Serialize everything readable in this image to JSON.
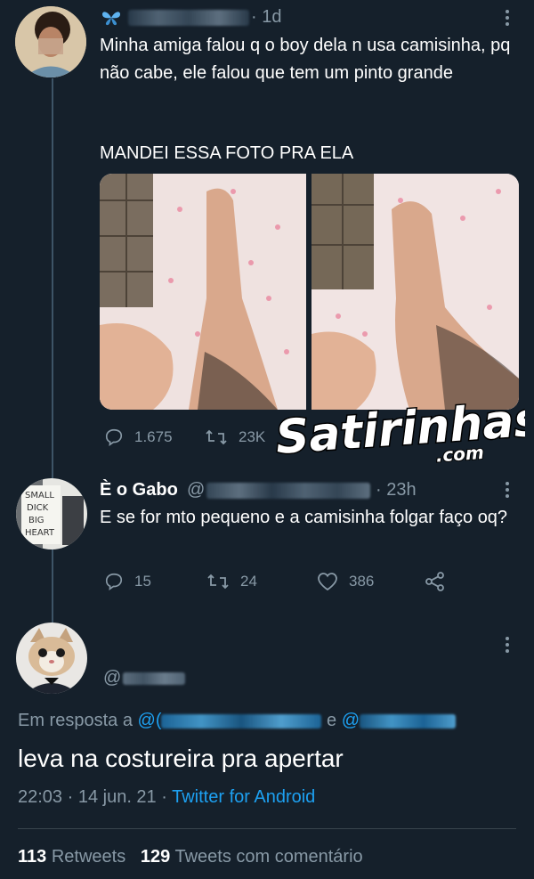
{
  "tweet1": {
    "handle_blur": "",
    "time": "· 1d",
    "text": "Minha amiga falou q o boy dela n usa camisinha, pq não cabe, ele falou que tem um pinto grande",
    "text2": "MANDEI ESSA FOTO PRA ELA",
    "replies": "1.675",
    "retweets": "23K",
    "name_icon": "butterfly-icon"
  },
  "watermark": {
    "main": "Satirinhas",
    "sub": ".com"
  },
  "tweet2": {
    "name": "È o Gabo",
    "at": "@",
    "time": "· 23h",
    "text": "E se for mto pequeno e a camisinha folgar faço oq?",
    "replies": "15",
    "retweets": "24",
    "likes": "386",
    "avatar_sign": [
      "SMALL",
      "DICK",
      "BIG",
      "HEART"
    ]
  },
  "tweet3": {
    "at": "@",
    "reply_prefix": "Em resposta a",
    "reply_at1": "@(",
    "reply_and": "e",
    "reply_at2": "@",
    "text": "leva na costureira pra apertar",
    "time": "22:03 · 14 jun. 21",
    "separator": "·",
    "client": "Twitter for Android",
    "retweets_count": "113",
    "retweets_label": "Retweets",
    "quotes_count": "129",
    "quotes_label": "Tweets com comentário"
  },
  "colors": {
    "background": "#15202b",
    "muted": "#8899a6",
    "link": "#1da1f2",
    "divider": "#38444d"
  }
}
